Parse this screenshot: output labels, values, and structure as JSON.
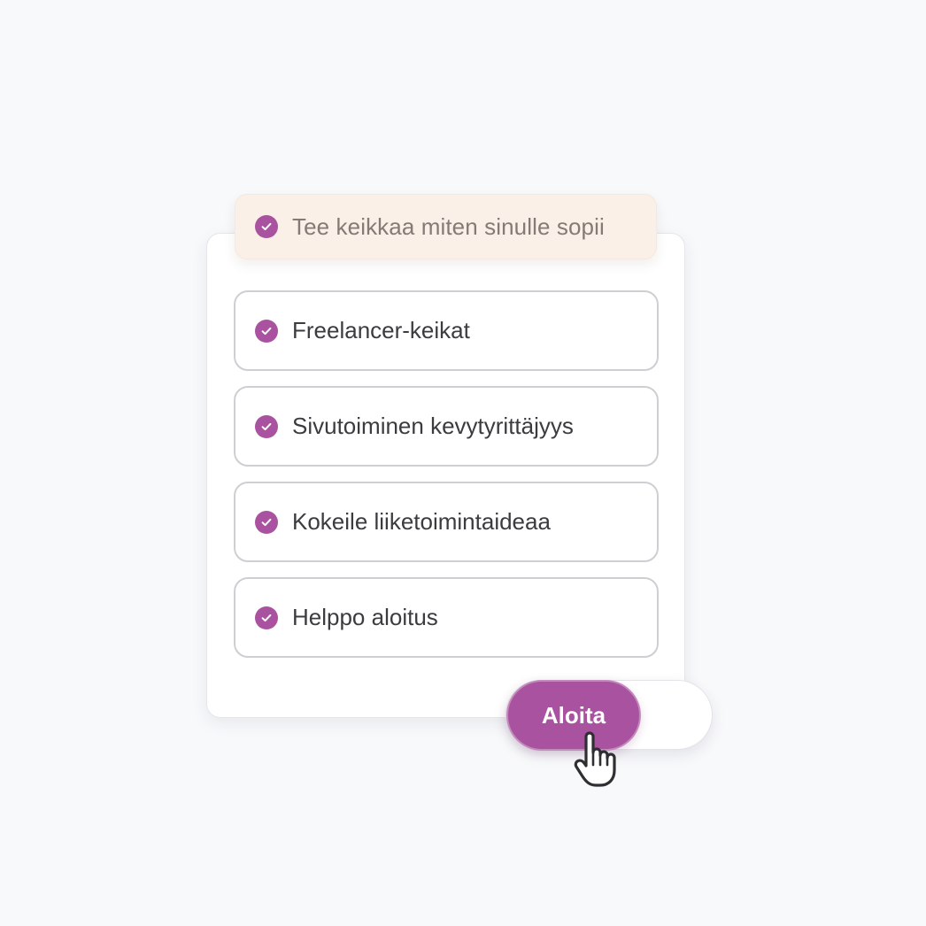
{
  "header": {
    "label": "Tee keikkaa miten sinulle sopii",
    "icon": "check-circle-icon"
  },
  "options": [
    {
      "label": "Freelancer-keikat",
      "icon": "check-circle-icon"
    },
    {
      "label": "Sivutoiminen kevytyrittäjyys",
      "icon": "check-circle-icon"
    },
    {
      "label": "Kokeile liiketoimintaideaa",
      "icon": "check-circle-icon"
    },
    {
      "label": "Helppo aloitus",
      "icon": "check-circle-icon"
    }
  ],
  "cta": {
    "label": "Aloita",
    "cursor_icon": "hand-pointer-icon"
  },
  "colors": {
    "accent": "#a9529f",
    "header_background": "#fbf0e7",
    "page_background": "#f8f9fb"
  }
}
